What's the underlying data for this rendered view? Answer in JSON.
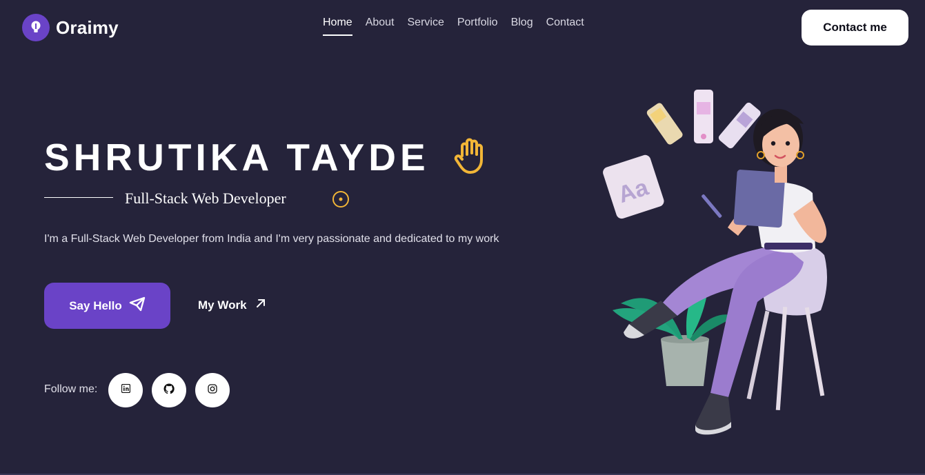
{
  "brand": {
    "name": "Oraimy"
  },
  "nav": {
    "items": [
      {
        "label": "Home",
        "active": true
      },
      {
        "label": "About"
      },
      {
        "label": "Service"
      },
      {
        "label": "Portfolio"
      },
      {
        "label": "Blog"
      },
      {
        "label": "Contact"
      }
    ]
  },
  "header": {
    "contact_label": "Contact me"
  },
  "hero": {
    "name": "SHRUTIKA TAYDE",
    "role": "Full-Stack Web Developer",
    "intro": "I'm a Full-Stack Web Developer from India and I'm very passionate and dedicated to my work",
    "primary_cta": "Say Hello",
    "secondary_cta": "My Work"
  },
  "social": {
    "label": "Follow me:",
    "links": [
      {
        "icon": "linkedin-icon"
      },
      {
        "icon": "github-icon"
      },
      {
        "icon": "instagram-icon"
      }
    ]
  },
  "colors": {
    "background": "#25233a",
    "accent": "#6a43c7",
    "highlight": "#f2b637"
  },
  "illustration": {
    "icon": "developer-sitting-illustration"
  }
}
